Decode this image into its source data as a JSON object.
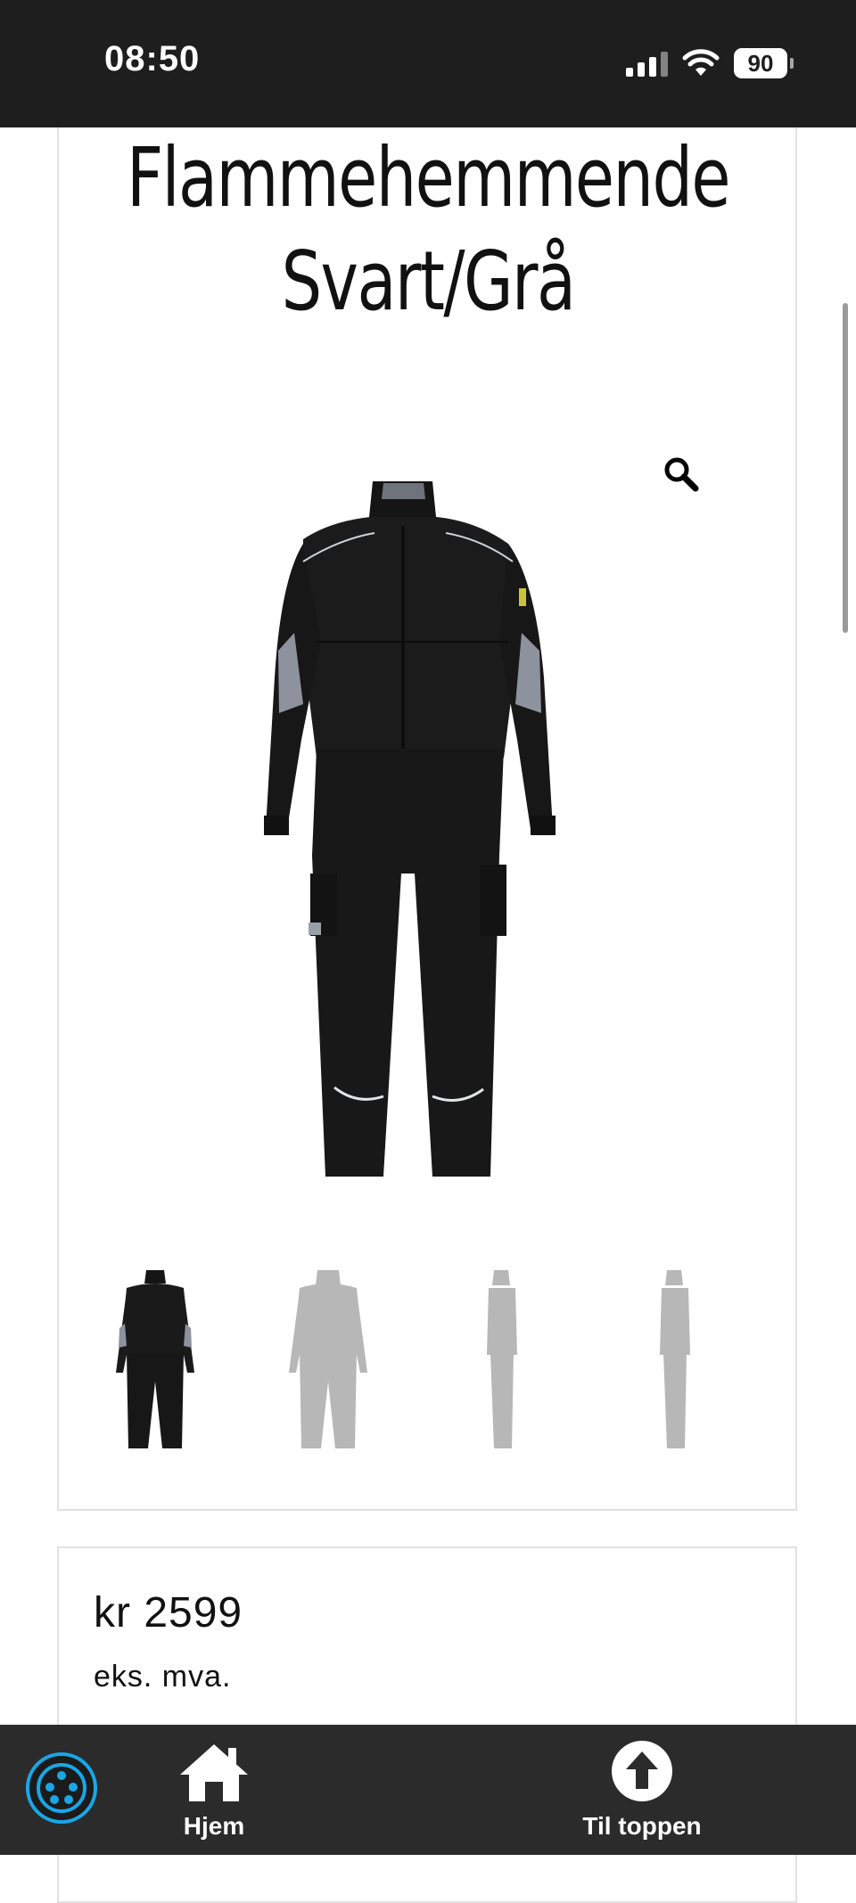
{
  "status_bar": {
    "time": "08:50",
    "battery": "90"
  },
  "product": {
    "title_line1": "Flammehemmende",
    "title_line2": "Svart/Grå",
    "thumbnail_count": 4
  },
  "price": {
    "amount": "kr 2599",
    "vat_note": "eks. mva."
  },
  "bottom_nav": {
    "home_label": "Hjem",
    "top_label": "Til toppen"
  },
  "colors": {
    "status_bg": "#1e1e1e",
    "nav_bg": "#2b2b2b",
    "accent": "#1aa6e6",
    "garment_black": "#151515",
    "garment_grey": "#8d929c"
  }
}
